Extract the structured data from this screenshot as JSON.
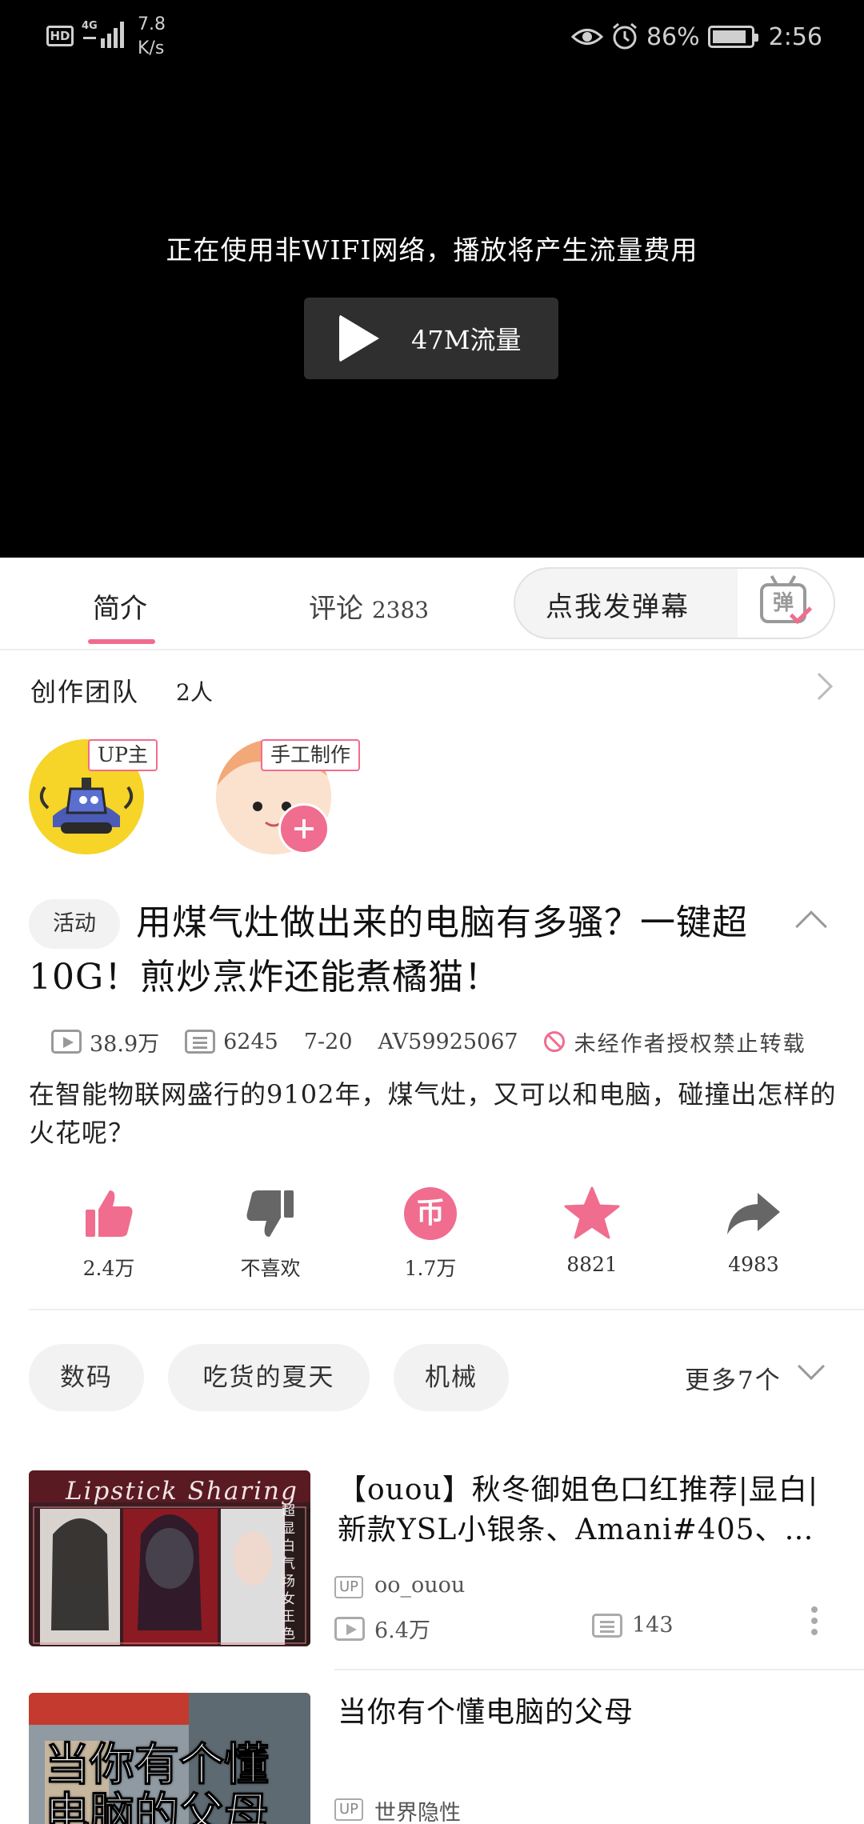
{
  "status_bar": {
    "hd": "HD",
    "network": "4G",
    "speed_value": "7.8",
    "speed_unit": "K/s",
    "battery": "86%",
    "time": "2:56"
  },
  "player": {
    "warning": "正在使用非WIFI网络，播放将产生流量费用",
    "play_label": "47M流量"
  },
  "tabs": {
    "intro": "简介",
    "comments": "评论",
    "comments_count": "2383",
    "danmaku_button": "点我发弹幕",
    "danmaku_icon": "弹"
  },
  "team": {
    "title": "创作团队",
    "count": "2人",
    "members": [
      {
        "badge": "UP主"
      },
      {
        "badge": "手工制作"
      }
    ]
  },
  "video": {
    "tag": "活动",
    "title": "用煤气灶做出来的电脑有多骚？一键超10G！煎炒烹炸还能煮橘猫！",
    "views": "38.9万",
    "danmaku": "6245",
    "date": "7-20",
    "av": "AV59925067",
    "no_repost": "未经作者授权禁止转载",
    "description": "在智能物联网盛行的9102年，煤气灶，又可以和电脑，碰撞出怎样的火花呢？"
  },
  "actions": [
    {
      "icon": "thumbs-up-icon",
      "label": "2.4万"
    },
    {
      "icon": "thumbs-down-icon",
      "label": "不喜欢"
    },
    {
      "icon": "coin-icon",
      "label": "1.7万"
    },
    {
      "icon": "star-icon",
      "label": "8821"
    },
    {
      "icon": "share-icon",
      "label": "4983"
    }
  ],
  "tags": [
    "数码",
    "吃货的夏天",
    "机械"
  ],
  "more_tags": "更多7个",
  "related": [
    {
      "title": "【ouou】秋冬御姐色口红推荐|显白|新款YSL小银条、Amani#405、…",
      "up_label": "UP",
      "up_name": "oo_ouou",
      "views": "6.4万",
      "danmaku": "143",
      "thumb_caption": "Lipstick Sharing",
      "thumb_side": "超显白气场女王色"
    },
    {
      "title": "当你有个懂电脑的父母",
      "up_label": "UP",
      "up_name": "世界隐性",
      "thumb_caption": "当你有个懂电脑的父母"
    }
  ],
  "colors": {
    "accent": "#f06d8f",
    "player_bg": "#000000"
  }
}
